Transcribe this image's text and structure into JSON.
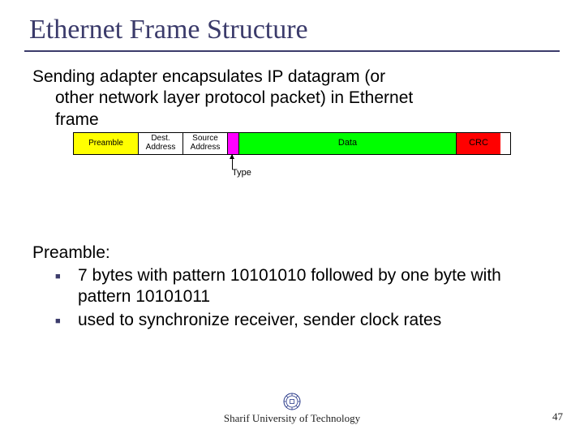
{
  "title": "Ethernet Frame Structure",
  "intro_line1": "Sending adapter encapsulates IP datagram (or",
  "intro_line2": "other network layer protocol packet) in Ethernet",
  "intro_line3": "frame",
  "frame": {
    "preamble": "Preamble",
    "dest": "Dest.\nAddress",
    "src": "Source\nAddress",
    "data": "Data",
    "crc": "CRC",
    "type_label": "Type"
  },
  "section_heading": "Preamble:",
  "bullets": [
    "7 bytes with pattern 10101010 followed by one byte with pattern 10101011",
    " used to synchronize receiver, sender clock rates"
  ],
  "footer": "Sharif University of Technology",
  "page_number": "47"
}
